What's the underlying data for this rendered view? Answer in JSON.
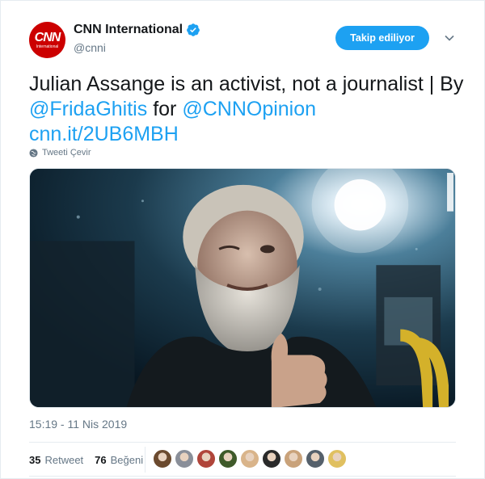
{
  "account": {
    "display_name": "CNN International",
    "handle": "@cnni",
    "avatar_logo": "CNN",
    "avatar_sub": "International",
    "verified": true
  },
  "follow_button": {
    "label": "Takip ediliyor"
  },
  "tweet": {
    "text_part1": "Julian Assange is an activist, not a journalist | By ",
    "mention1": "@FridaGhitis",
    "text_part2": " for ",
    "mention2": "@CNNOpinion",
    "link": "cnn.it/2UB6MBH"
  },
  "translate_label": "Tweeti Çevir",
  "timestamp": "15:19 - 11 Nis 2019",
  "stats": {
    "retweets_count": "35",
    "retweets_label": "Retweet",
    "likes_count": "76",
    "likes_label": "Beğeni"
  },
  "likers": [
    {
      "color": "#6b4a2e"
    },
    {
      "color": "#8a8f99"
    },
    {
      "color": "#b0453a"
    },
    {
      "color": "#3f5a2a"
    },
    {
      "color": "#d9b48a"
    },
    {
      "color": "#2a2a2a"
    },
    {
      "color": "#c9a27a"
    },
    {
      "color": "#55606b"
    },
    {
      "color": "#e0c060"
    }
  ],
  "colors": {
    "accent": "#1da1f2",
    "brand_red": "#cc0000",
    "text": "#14171a",
    "muted": "#657786"
  }
}
